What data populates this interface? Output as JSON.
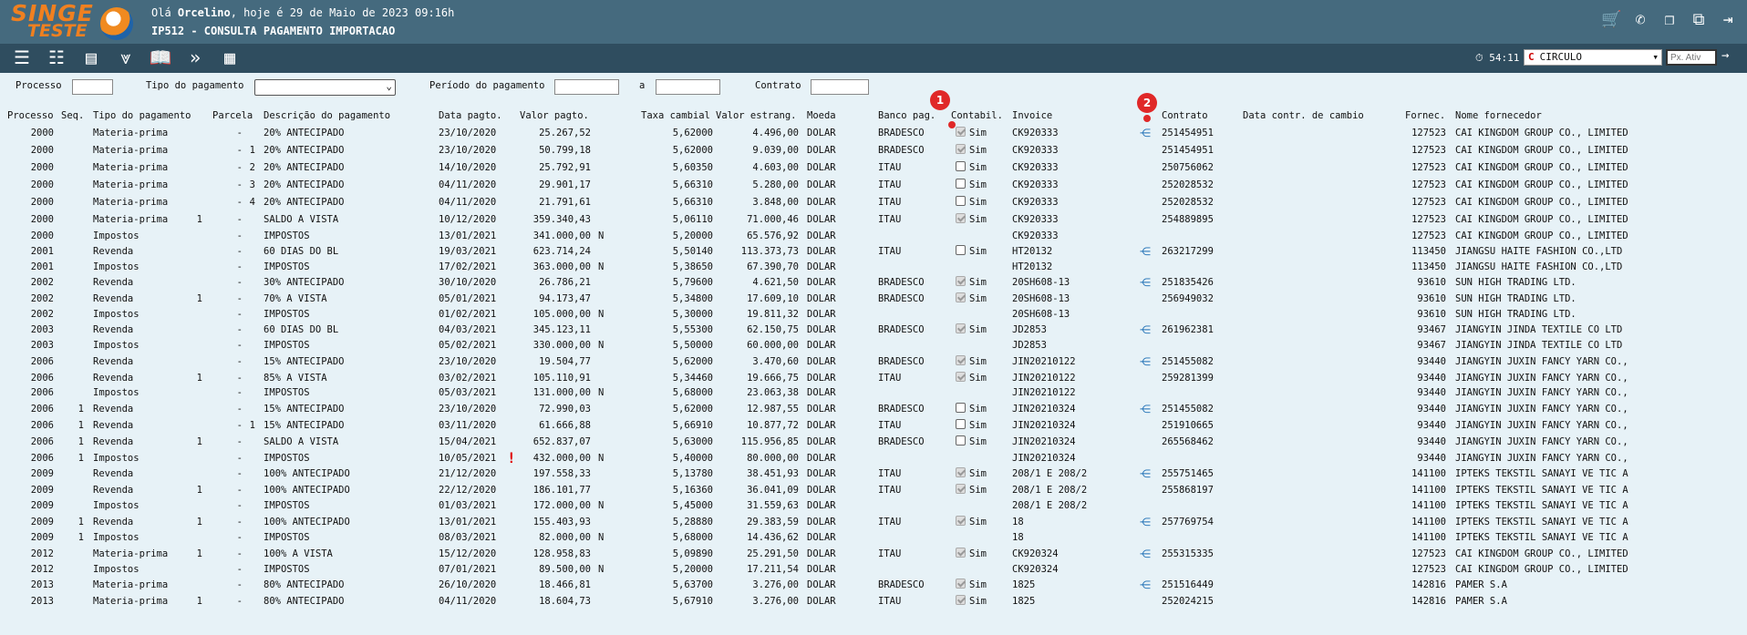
{
  "header": {
    "logo_top": "SINGE",
    "logo_bottom": "TESTE",
    "greeting_prefix": "Olá ",
    "user": "Orcelino",
    "greeting_suffix": ", hoje é 29 de Maio de 2023 09:16h",
    "screen_title": "IP512 - CONSULTA PAGAMENTO IMPORTACAO"
  },
  "toolbar": {
    "timer": "54:11",
    "company_value": "CIRCULO",
    "px_ativ_placeholder": "Px. Ativ"
  },
  "filters": {
    "processo_label": "Processo",
    "tipo_label": "Tipo do pagamento",
    "periodo_label": "Período do pagamento",
    "a_label": "a",
    "contrato_label": "Contrato"
  },
  "columns": {
    "processo": "Processo",
    "seq": "Seq.",
    "tipo": "Tipo do pagamento",
    "parcela": "Parcela",
    "descricao": "Descrição do pagamento",
    "data": "Data pagto.",
    "valor": "Valor pagto.",
    "taxa": "Taxa cambial",
    "valor_estrang": "Valor estrang.",
    "moeda": "Moeda",
    "banco": "Banco pag.",
    "contabil": "Contabil.",
    "invoice": "Invoice",
    "contrato": "Contrato",
    "data_contr": "Data contr. de cambio",
    "fornec": "Fornec.",
    "nome": "Nome fornecedor"
  },
  "badges": [
    "1",
    "2"
  ],
  "rows": [
    {
      "proc": "2000",
      "seq": "",
      "tipo": "Materia-prima",
      "p1": "",
      "p2": "-",
      "p3": "",
      "desc": "20% ANTECIPADO",
      "data": "23/10/2020",
      "warn": "",
      "valor": "25.267,52",
      "n": "",
      "taxa": "5,62000",
      "vest": "4.496,00",
      "moeda": "DOLAR",
      "banco": "BRADESCO",
      "cb": "dis",
      "sim": "Sim",
      "inv": "CK920333",
      "tree": true,
      "contr": "251454951",
      "forn": "127523",
      "nome": "CAI KINGDOM GROUP CO., LIMITED"
    },
    {
      "proc": "2000",
      "seq": "",
      "tipo": "Materia-prima",
      "p1": "",
      "p2": "-",
      "p3": "1",
      "desc": "20% ANTECIPADO",
      "data": "23/10/2020",
      "warn": "",
      "valor": "50.799,18",
      "n": "",
      "taxa": "5,62000",
      "vest": "9.039,00",
      "moeda": "DOLAR",
      "banco": "BRADESCO",
      "cb": "dis",
      "sim": "Sim",
      "inv": "CK920333",
      "tree": false,
      "contr": "251454951",
      "forn": "127523",
      "nome": "CAI KINGDOM GROUP CO., LIMITED"
    },
    {
      "proc": "2000",
      "seq": "",
      "tipo": "Materia-prima",
      "p1": "",
      "p2": "-",
      "p3": "2",
      "desc": "20% ANTECIPADO",
      "data": "14/10/2020",
      "warn": "",
      "valor": "25.792,91",
      "n": "",
      "taxa": "5,60350",
      "vest": "4.603,00",
      "moeda": "DOLAR",
      "banco": "ITAU",
      "cb": "on",
      "sim": "Sim",
      "inv": "CK920333",
      "tree": false,
      "contr": "250756062",
      "forn": "127523",
      "nome": "CAI KINGDOM GROUP CO., LIMITED"
    },
    {
      "proc": "2000",
      "seq": "",
      "tipo": "Materia-prima",
      "p1": "",
      "p2": "-",
      "p3": "3",
      "desc": "20% ANTECIPADO",
      "data": "04/11/2020",
      "warn": "",
      "valor": "29.901,17",
      "n": "",
      "taxa": "5,66310",
      "vest": "5.280,00",
      "moeda": "DOLAR",
      "banco": "ITAU",
      "cb": "on",
      "sim": "Sim",
      "inv": "CK920333",
      "tree": false,
      "contr": "252028532",
      "forn": "127523",
      "nome": "CAI KINGDOM GROUP CO., LIMITED"
    },
    {
      "proc": "2000",
      "seq": "",
      "tipo": "Materia-prima",
      "p1": "",
      "p2": "-",
      "p3": "4",
      "desc": "20% ANTECIPADO",
      "data": "04/11/2020",
      "warn": "",
      "valor": "21.791,61",
      "n": "",
      "taxa": "5,66310",
      "vest": "3.848,00",
      "moeda": "DOLAR",
      "banco": "ITAU",
      "cb": "on",
      "sim": "Sim",
      "inv": "CK920333",
      "tree": false,
      "contr": "252028532",
      "forn": "127523",
      "nome": "CAI KINGDOM GROUP CO., LIMITED"
    },
    {
      "proc": "2000",
      "seq": "",
      "tipo": "Materia-prima",
      "p1": "1",
      "p2": "-",
      "p3": "",
      "desc": "SALDO A VISTA",
      "data": "10/12/2020",
      "warn": "",
      "valor": "359.340,43",
      "n": "",
      "taxa": "5,06110",
      "vest": "71.000,46",
      "moeda": "DOLAR",
      "banco": "ITAU",
      "cb": "dis",
      "sim": "Sim",
      "inv": "CK920333",
      "tree": false,
      "contr": "254889895",
      "forn": "127523",
      "nome": "CAI KINGDOM GROUP CO., LIMITED"
    },
    {
      "proc": "2000",
      "seq": "",
      "tipo": "Impostos",
      "p1": "",
      "p2": "-",
      "p3": "",
      "desc": "IMPOSTOS",
      "data": "13/01/2021",
      "warn": "",
      "valor": "341.000,00",
      "n": "N",
      "taxa": "5,20000",
      "vest": "65.576,92",
      "moeda": "DOLAR",
      "banco": "",
      "cb": "",
      "sim": "",
      "inv": "CK920333",
      "tree": false,
      "contr": "",
      "forn": "127523",
      "nome": "CAI KINGDOM GROUP CO., LIMITED"
    },
    {
      "proc": "2001",
      "seq": "",
      "tipo": "Revenda",
      "p1": "",
      "p2": "-",
      "p3": "",
      "desc": "60 DIAS DO BL",
      "data": "19/03/2021",
      "warn": "",
      "valor": "623.714,24",
      "n": "",
      "taxa": "5,50140",
      "vest": "113.373,73",
      "moeda": "DOLAR",
      "banco": "ITAU",
      "cb": "on",
      "sim": "Sim",
      "inv": "HT20132",
      "tree": true,
      "contr": "263217299",
      "forn": "113450",
      "nome": "JIANGSU HAITE FASHION CO.,LTD"
    },
    {
      "proc": "2001",
      "seq": "",
      "tipo": "Impostos",
      "p1": "",
      "p2": "-",
      "p3": "",
      "desc": "IMPOSTOS",
      "data": "17/02/2021",
      "warn": "",
      "valor": "363.000,00",
      "n": "N",
      "taxa": "5,38650",
      "vest": "67.390,70",
      "moeda": "DOLAR",
      "banco": "",
      "cb": "",
      "sim": "",
      "inv": "HT20132",
      "tree": false,
      "contr": "",
      "forn": "113450",
      "nome": "JIANGSU HAITE FASHION CO.,LTD"
    },
    {
      "proc": "2002",
      "seq": "",
      "tipo": "Revenda",
      "p1": "",
      "p2": "-",
      "p3": "",
      "desc": "30% ANTECIPADO",
      "data": "30/10/2020",
      "warn": "",
      "valor": "26.786,21",
      "n": "",
      "taxa": "5,79600",
      "vest": "4.621,50",
      "moeda": "DOLAR",
      "banco": "BRADESCO",
      "cb": "dis",
      "sim": "Sim",
      "inv": "20SH608-13",
      "tree": true,
      "contr": "251835426",
      "forn": "93610",
      "nome": "SUN HIGH TRADING LTD."
    },
    {
      "proc": "2002",
      "seq": "",
      "tipo": "Revenda",
      "p1": "1",
      "p2": "-",
      "p3": "",
      "desc": "70% A VISTA",
      "data": "05/01/2021",
      "warn": "",
      "valor": "94.173,47",
      "n": "",
      "taxa": "5,34800",
      "vest": "17.609,10",
      "moeda": "DOLAR",
      "banco": "BRADESCO",
      "cb": "dis",
      "sim": "Sim",
      "inv": "20SH608-13",
      "tree": false,
      "contr": "256949032",
      "forn": "93610",
      "nome": "SUN HIGH TRADING LTD."
    },
    {
      "proc": "2002",
      "seq": "",
      "tipo": "Impostos",
      "p1": "",
      "p2": "-",
      "p3": "",
      "desc": "IMPOSTOS",
      "data": "01/02/2021",
      "warn": "",
      "valor": "105.000,00",
      "n": "N",
      "taxa": "5,30000",
      "vest": "19.811,32",
      "moeda": "DOLAR",
      "banco": "",
      "cb": "",
      "sim": "",
      "inv": "20SH608-13",
      "tree": false,
      "contr": "",
      "forn": "93610",
      "nome": "SUN HIGH TRADING LTD."
    },
    {
      "proc": "2003",
      "seq": "",
      "tipo": "Revenda",
      "p1": "",
      "p2": "-",
      "p3": "",
      "desc": "60 DIAS DO BL",
      "data": "04/03/2021",
      "warn": "",
      "valor": "345.123,11",
      "n": "",
      "taxa": "5,55300",
      "vest": "62.150,75",
      "moeda": "DOLAR",
      "banco": "BRADESCO",
      "cb": "dis",
      "sim": "Sim",
      "inv": "JD2853",
      "tree": true,
      "contr": "261962381",
      "forn": "93467",
      "nome": "JIANGYIN JINDA TEXTILE CO LTD"
    },
    {
      "proc": "2003",
      "seq": "",
      "tipo": "Impostos",
      "p1": "",
      "p2": "-",
      "p3": "",
      "desc": "IMPOSTOS",
      "data": "05/02/2021",
      "warn": "",
      "valor": "330.000,00",
      "n": "N",
      "taxa": "5,50000",
      "vest": "60.000,00",
      "moeda": "DOLAR",
      "banco": "",
      "cb": "",
      "sim": "",
      "inv": "JD2853",
      "tree": false,
      "contr": "",
      "forn": "93467",
      "nome": "JIANGYIN JINDA TEXTILE CO LTD"
    },
    {
      "proc": "2006",
      "seq": "",
      "tipo": "Revenda",
      "p1": "",
      "p2": "-",
      "p3": "",
      "desc": "15% ANTECIPADO",
      "data": "23/10/2020",
      "warn": "",
      "valor": "19.504,77",
      "n": "",
      "taxa": "5,62000",
      "vest": "3.470,60",
      "moeda": "DOLAR",
      "banco": "BRADESCO",
      "cb": "dis",
      "sim": "Sim",
      "inv": "JIN20210122",
      "tree": true,
      "contr": "251455082",
      "forn": "93440",
      "nome": "JIANGYIN JUXIN FANCY YARN CO.,"
    },
    {
      "proc": "2006",
      "seq": "",
      "tipo": "Revenda",
      "p1": "1",
      "p2": "-",
      "p3": "",
      "desc": "85% A VISTA",
      "data": "03/02/2021",
      "warn": "",
      "valor": "105.110,91",
      "n": "",
      "taxa": "5,34460",
      "vest": "19.666,75",
      "moeda": "DOLAR",
      "banco": "ITAU",
      "cb": "dis",
      "sim": "Sim",
      "inv": "JIN20210122",
      "tree": false,
      "contr": "259281399",
      "forn": "93440",
      "nome": "JIANGYIN JUXIN FANCY YARN CO.,"
    },
    {
      "proc": "2006",
      "seq": "",
      "tipo": "Impostos",
      "p1": "",
      "p2": "-",
      "p3": "",
      "desc": "IMPOSTOS",
      "data": "05/03/2021",
      "warn": "",
      "valor": "131.000,00",
      "n": "N",
      "taxa": "5,68000",
      "vest": "23.063,38",
      "moeda": "DOLAR",
      "banco": "",
      "cb": "",
      "sim": "",
      "inv": "JIN20210122",
      "tree": false,
      "contr": "",
      "forn": "93440",
      "nome": "JIANGYIN JUXIN FANCY YARN CO.,"
    },
    {
      "proc": "2006",
      "seq": "1",
      "tipo": "Revenda",
      "p1": "",
      "p2": "-",
      "p3": "",
      "desc": "15% ANTECIPADO",
      "data": "23/10/2020",
      "warn": "",
      "valor": "72.990,03",
      "n": "",
      "taxa": "5,62000",
      "vest": "12.987,55",
      "moeda": "DOLAR",
      "banco": "BRADESCO",
      "cb": "on",
      "sim": "Sim",
      "inv": "JIN20210324",
      "tree": true,
      "contr": "251455082",
      "forn": "93440",
      "nome": "JIANGYIN JUXIN FANCY YARN CO.,"
    },
    {
      "proc": "2006",
      "seq": "1",
      "tipo": "Revenda",
      "p1": "",
      "p2": "-",
      "p3": "1",
      "desc": "15% ANTECIPADO",
      "data": "03/11/2020",
      "warn": "",
      "valor": "61.666,88",
      "n": "",
      "taxa": "5,66910",
      "vest": "10.877,72",
      "moeda": "DOLAR",
      "banco": "ITAU",
      "cb": "on",
      "sim": "Sim",
      "inv": "JIN20210324",
      "tree": false,
      "contr": "251910665",
      "forn": "93440",
      "nome": "JIANGYIN JUXIN FANCY YARN CO.,"
    },
    {
      "proc": "2006",
      "seq": "1",
      "tipo": "Revenda",
      "p1": "1",
      "p2": "-",
      "p3": "",
      "desc": "SALDO A VISTA",
      "data": "15/04/2021",
      "warn": "",
      "valor": "652.837,07",
      "n": "",
      "taxa": "5,63000",
      "vest": "115.956,85",
      "moeda": "DOLAR",
      "banco": "BRADESCO",
      "cb": "on",
      "sim": "Sim",
      "inv": "JIN20210324",
      "tree": false,
      "contr": "265568462",
      "forn": "93440",
      "nome": "JIANGYIN JUXIN FANCY YARN CO.,"
    },
    {
      "proc": "2006",
      "seq": "1",
      "tipo": "Impostos",
      "p1": "",
      "p2": "-",
      "p3": "",
      "desc": "IMPOSTOS",
      "data": "10/05/2021",
      "warn": "!",
      "valor": "432.000,00",
      "n": "N",
      "taxa": "5,40000",
      "vest": "80.000,00",
      "moeda": "DOLAR",
      "banco": "",
      "cb": "",
      "sim": "",
      "inv": "JIN20210324",
      "tree": false,
      "contr": "",
      "forn": "93440",
      "nome": "JIANGYIN JUXIN FANCY YARN CO.,"
    },
    {
      "proc": "2009",
      "seq": "",
      "tipo": "Revenda",
      "p1": "",
      "p2": "-",
      "p3": "",
      "desc": "100% ANTECIPADO",
      "data": "21/12/2020",
      "warn": "",
      "valor": "197.558,33",
      "n": "",
      "taxa": "5,13780",
      "vest": "38.451,93",
      "moeda": "DOLAR",
      "banco": "ITAU",
      "cb": "dis",
      "sim": "Sim",
      "inv": "208/1 E 208/2",
      "tree": true,
      "contr": "255751465",
      "forn": "141100",
      "nome": "IPTEKS TEKSTIL SANAYI VE TIC A"
    },
    {
      "proc": "2009",
      "seq": "",
      "tipo": "Revenda",
      "p1": "1",
      "p2": "-",
      "p3": "",
      "desc": "100% ANTECIPADO",
      "data": "22/12/2020",
      "warn": "",
      "valor": "186.101,77",
      "n": "",
      "taxa": "5,16360",
      "vest": "36.041,09",
      "moeda": "DOLAR",
      "banco": "ITAU",
      "cb": "dis",
      "sim": "Sim",
      "inv": "208/1 E 208/2",
      "tree": false,
      "contr": "255868197",
      "forn": "141100",
      "nome": "IPTEKS TEKSTIL SANAYI VE TIC A"
    },
    {
      "proc": "2009",
      "seq": "",
      "tipo": "Impostos",
      "p1": "",
      "p2": "-",
      "p3": "",
      "desc": "IMPOSTOS",
      "data": "01/03/2021",
      "warn": "",
      "valor": "172.000,00",
      "n": "N",
      "taxa": "5,45000",
      "vest": "31.559,63",
      "moeda": "DOLAR",
      "banco": "",
      "cb": "",
      "sim": "",
      "inv": "208/1 E 208/2",
      "tree": false,
      "contr": "",
      "forn": "141100",
      "nome": "IPTEKS TEKSTIL SANAYI VE TIC A"
    },
    {
      "proc": "2009",
      "seq": "1",
      "tipo": "Revenda",
      "p1": "1",
      "p2": "-",
      "p3": "",
      "desc": "100% ANTECIPADO",
      "data": "13/01/2021",
      "warn": "",
      "valor": "155.403,93",
      "n": "",
      "taxa": "5,28880",
      "vest": "29.383,59",
      "moeda": "DOLAR",
      "banco": "ITAU",
      "cb": "dis",
      "sim": "Sim",
      "inv": "18",
      "tree": true,
      "contr": "257769754",
      "forn": "141100",
      "nome": "IPTEKS TEKSTIL SANAYI VE TIC A"
    },
    {
      "proc": "2009",
      "seq": "1",
      "tipo": "Impostos",
      "p1": "",
      "p2": "-",
      "p3": "",
      "desc": "IMPOSTOS",
      "data": "08/03/2021",
      "warn": "",
      "valor": "82.000,00",
      "n": "N",
      "taxa": "5,68000",
      "vest": "14.436,62",
      "moeda": "DOLAR",
      "banco": "",
      "cb": "",
      "sim": "",
      "inv": "18",
      "tree": false,
      "contr": "",
      "forn": "141100",
      "nome": "IPTEKS TEKSTIL SANAYI VE TIC A"
    },
    {
      "proc": "2012",
      "seq": "",
      "tipo": "Materia-prima",
      "p1": "1",
      "p2": "-",
      "p3": "",
      "desc": "100% A VISTA",
      "data": "15/12/2020",
      "warn": "",
      "valor": "128.958,83",
      "n": "",
      "taxa": "5,09890",
      "vest": "25.291,50",
      "moeda": "DOLAR",
      "banco": "ITAU",
      "cb": "dis",
      "sim": "Sim",
      "inv": "CK920324",
      "tree": true,
      "contr": "255315335",
      "forn": "127523",
      "nome": "CAI KINGDOM GROUP CO., LIMITED"
    },
    {
      "proc": "2012",
      "seq": "",
      "tipo": "Impostos",
      "p1": "",
      "p2": "-",
      "p3": "",
      "desc": "IMPOSTOS",
      "data": "07/01/2021",
      "warn": "",
      "valor": "89.500,00",
      "n": "N",
      "taxa": "5,20000",
      "vest": "17.211,54",
      "moeda": "DOLAR",
      "banco": "",
      "cb": "",
      "sim": "",
      "inv": "CK920324",
      "tree": false,
      "contr": "",
      "forn": "127523",
      "nome": "CAI KINGDOM GROUP CO., LIMITED"
    },
    {
      "proc": "2013",
      "seq": "",
      "tipo": "Materia-prima",
      "p1": "",
      "p2": "-",
      "p3": "",
      "desc": "80% ANTECIPADO",
      "data": "26/10/2020",
      "warn": "",
      "valor": "18.466,81",
      "n": "",
      "taxa": "5,63700",
      "vest": "3.276,00",
      "moeda": "DOLAR",
      "banco": "BRADESCO",
      "cb": "dis",
      "sim": "Sim",
      "inv": "1825",
      "tree": true,
      "contr": "251516449",
      "forn": "142816",
      "nome": "PAMER S.A"
    },
    {
      "proc": "2013",
      "seq": "",
      "tipo": "Materia-prima",
      "p1": "1",
      "p2": "-",
      "p3": "",
      "desc": "80% ANTECIPADO",
      "data": "04/11/2020",
      "warn": "",
      "valor": "18.604,73",
      "n": "",
      "taxa": "5,67910",
      "vest": "3.276,00",
      "moeda": "DOLAR",
      "banco": "ITAU",
      "cb": "dis",
      "sim": "Sim",
      "inv": "1825",
      "tree": false,
      "contr": "252024215",
      "forn": "142816",
      "nome": "PAMER S.A"
    }
  ]
}
